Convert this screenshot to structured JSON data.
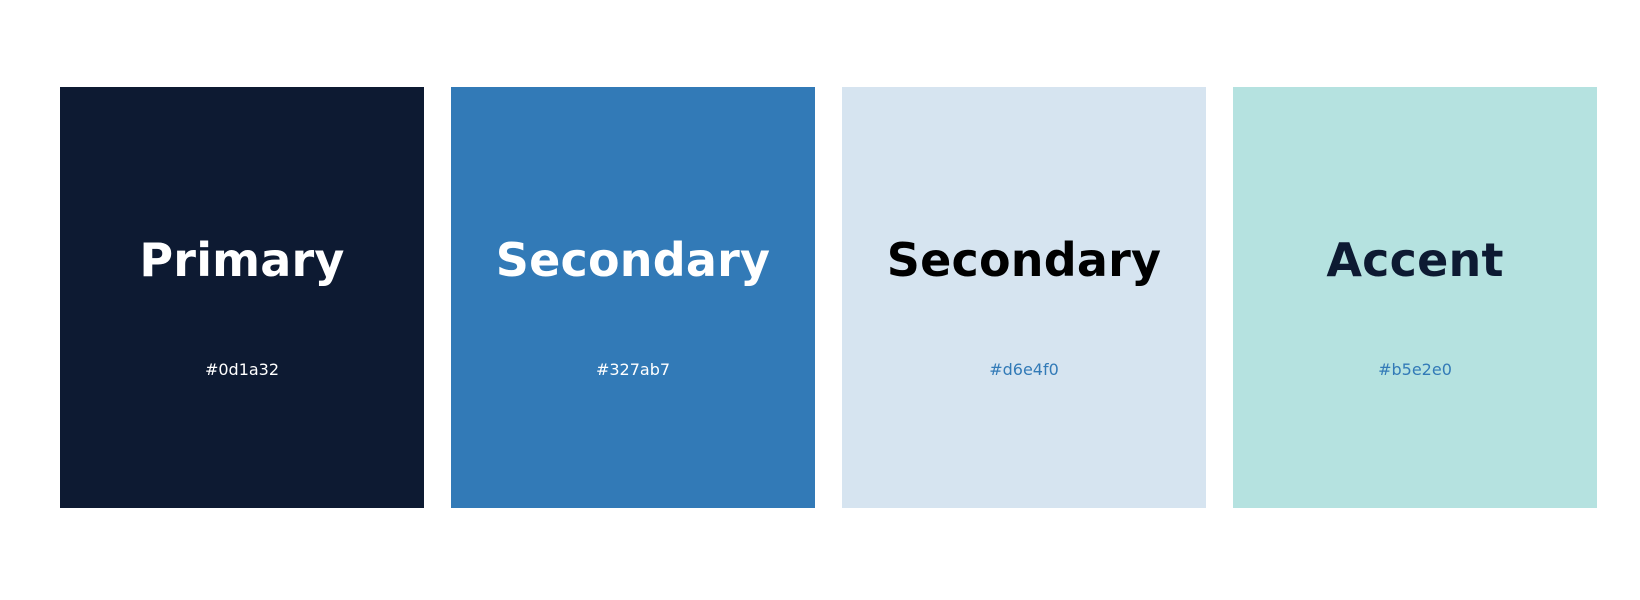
{
  "palette": {
    "swatches": [
      {
        "name": "Primary",
        "hex": "#0d1a32",
        "color": "#0d1a32",
        "text_color": "#ffffff",
        "hex_color": "#ffffff"
      },
      {
        "name": "Secondary",
        "hex": "#327ab7",
        "color": "#327ab7",
        "text_color": "#ffffff",
        "hex_color": "#ffffff"
      },
      {
        "name": "Secondary",
        "hex": "#d6e4f0",
        "color": "#d6e4f0",
        "text_color": "#000000",
        "hex_color": "#327ab7"
      },
      {
        "name": "Accent",
        "hex": "#b5e2e0",
        "color": "#b5e2e0",
        "text_color": "#0d1a32",
        "hex_color": "#327ab7"
      }
    ]
  }
}
